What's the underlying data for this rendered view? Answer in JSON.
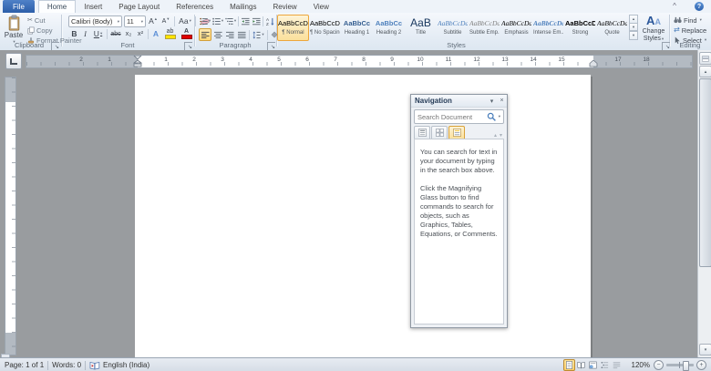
{
  "ribbon": {
    "tabs": [
      {
        "label": "File"
      },
      {
        "label": "Home"
      },
      {
        "label": "Insert"
      },
      {
        "label": "Page Layout"
      },
      {
        "label": "References"
      },
      {
        "label": "Mailings"
      },
      {
        "label": "Review"
      },
      {
        "label": "View"
      }
    ],
    "active_tab": "Home",
    "clipboard": {
      "label": "Clipboard",
      "paste_label": "Paste",
      "cut_label": "Cut",
      "copy_label": "Copy",
      "format_painter_label": "Format Painter"
    },
    "font": {
      "label": "Font",
      "family": "Calibri (Body)",
      "size": "11",
      "bold": "B",
      "italic": "I",
      "underline": "U",
      "strikethrough": "abc",
      "subscript": "x₂",
      "superscript": "x²",
      "text_effects": "A",
      "highlight": "ab",
      "font_color": "A",
      "grow_font": "A",
      "shrink_font": "A",
      "change_case": "Aa"
    },
    "paragraph": {
      "label": "Paragraph"
    },
    "styles": {
      "label": "Styles",
      "items": [
        {
          "preview": "AaBbCcDd",
          "name": "¶ Normal",
          "color": "#000000",
          "selected": true
        },
        {
          "preview": "AaBbCcDd",
          "name": "¶ No Spacing",
          "color": "#000000"
        },
        {
          "preview": "AaBbCc",
          "name": "Heading 1",
          "color": "#365f91",
          "bold": true
        },
        {
          "preview": "AaBbCc",
          "name": "Heading 2",
          "color": "#4f81bd",
          "bold": true
        },
        {
          "preview": "AaB",
          "name": "Title",
          "color": "#17365d",
          "big": true
        },
        {
          "preview": "AaBbCcDd",
          "name": "Subtitle",
          "color": "#4f81bd",
          "italic": true
        },
        {
          "preview": "AaBbCcDd",
          "name": "Subtle Emp...",
          "color": "#808080",
          "italic": true
        },
        {
          "preview": "AaBbCcDd",
          "name": "Emphasis",
          "color": "#000000",
          "italic": true
        },
        {
          "preview": "AaBbCcDd",
          "name": "Intense Em...",
          "color": "#4f81bd",
          "italic": true,
          "bold": true
        },
        {
          "preview": "AaBbCcDc",
          "name": "Strong",
          "color": "#000000",
          "bold": true
        },
        {
          "preview": "AaBbCcDd",
          "name": "Quote",
          "color": "#000000",
          "italic": true
        }
      ]
    },
    "change_styles": {
      "line1": "Change",
      "line2": "Styles"
    },
    "editing": {
      "label": "Editing",
      "find": "Find",
      "replace": "Replace",
      "select": "Select"
    }
  },
  "icons": {
    "dropdown": "▾",
    "up_arrow": "▴",
    "down_arrow": "▾",
    "close": "×",
    "scissors": "✂",
    "pilcrow": "¶",
    "replace": "⇄",
    "launcher": "↘",
    "minimize_ribbon": "^",
    "help": "?",
    "minus": "−",
    "plus": "+"
  },
  "ruler": {
    "left_numbers": [
      "2",
      "1"
    ],
    "numbers": [
      "1",
      "2",
      "3",
      "4",
      "5",
      "6",
      "7",
      "8",
      "9",
      "10",
      "11",
      "12",
      "13",
      "14",
      "15"
    ],
    "right_numbers": [
      "17",
      "18"
    ]
  },
  "navigation_pane": {
    "title": "Navigation",
    "search_placeholder": "Search Document",
    "paragraph1": "You can search for text in your document by typing in the search box above.",
    "paragraph2": "Click the Magnifying Glass button to find commands to search for objects, such as Graphics, Tables, Equations, or Comments."
  },
  "status_bar": {
    "page": "Page: 1 of 1",
    "words": "Words: 0",
    "language": "English (India)",
    "zoom_level": "120%"
  },
  "colors": {
    "accent_blue": "#2b579a",
    "selection_orange": "#eda73c",
    "ribbon_background": "#e7eef6",
    "document_background": "#999c9f",
    "status_background": "#dde4ec"
  }
}
